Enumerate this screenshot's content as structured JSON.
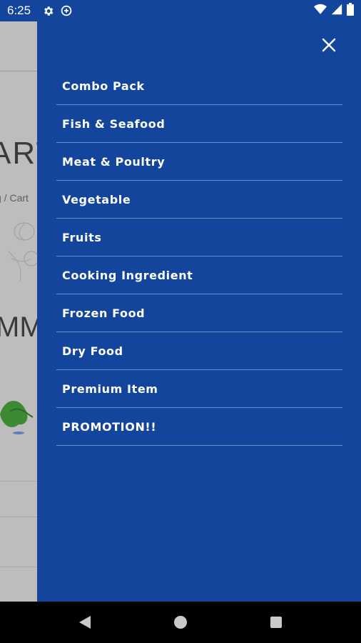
{
  "status_bar": {
    "time": "6:25",
    "icons": [
      "gear-icon",
      "data-saver-icon",
      "wifi-icon",
      "signal-icon",
      "battery-icon"
    ]
  },
  "background_page": {
    "title_fragment": "ART",
    "breadcrumb_fragment": "g / Cart",
    "summary_fragment": "MMA"
  },
  "drawer": {
    "background_color": "#14459c",
    "close_icon": "close-icon",
    "menu_items": [
      {
        "label": "Combo Pack"
      },
      {
        "label": "Fish & Seafood"
      },
      {
        "label": "Meat & Poultry"
      },
      {
        "label": "Vegetable"
      },
      {
        "label": "Fruits"
      },
      {
        "label": "Cooking Ingredient"
      },
      {
        "label": "Frozen Food"
      },
      {
        "label": "Dry Food"
      },
      {
        "label": "Premium Item"
      },
      {
        "label": "PROMOTION!!"
      }
    ]
  },
  "nav_bar": {
    "buttons": [
      "back-icon",
      "home-icon",
      "recents-icon"
    ]
  }
}
